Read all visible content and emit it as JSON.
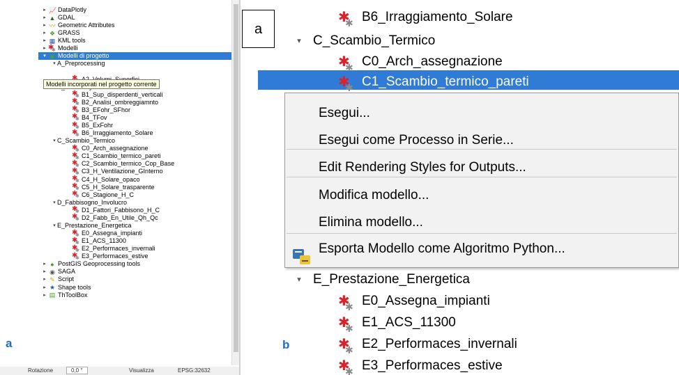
{
  "left_panel": {
    "label": "a",
    "tree": [
      {
        "text": "DataPlotly",
        "icon": "dataplotly-icon",
        "level": 0,
        "arrow": "▸"
      },
      {
        "text": "GDAL",
        "icon": "gdal-icon",
        "level": 0,
        "arrow": "▸"
      },
      {
        "text": "Geometric Attributes",
        "icon": "geometric-attributes-icon",
        "level": 0,
        "arrow": "▸"
      },
      {
        "text": "GRASS",
        "icon": "grass-icon",
        "level": 0,
        "arrow": "▸"
      },
      {
        "text": "KML tools",
        "icon": "kml-icon",
        "level": 0,
        "arrow": "▸"
      },
      {
        "text": "Modelli",
        "icon": "gear-icon",
        "level": 0,
        "arrow": "▸"
      },
      {
        "text": "Modelli di progetto",
        "icon": "project-models-icon",
        "level": 0,
        "arrow": "▾",
        "selected": true
      },
      {
        "text": "A_Preprocessing",
        "icon": "",
        "level": 1,
        "arrow": "▾"
      },
      {
        "text": "",
        "icon": "",
        "level": 2,
        "arrow": ""
      },
      {
        "text": "A2_Volumi_Superfici",
        "icon": "gear-icon",
        "level": 2,
        "arrow": ""
      },
      {
        "text": "B_Geometry",
        "icon": "",
        "level": 1,
        "arrow": "▾"
      },
      {
        "text": "B1_Sup_disperdenti_verticali",
        "icon": "gear-icon",
        "level": 2,
        "arrow": ""
      },
      {
        "text": "B2_Analisi_ombreggiamnto",
        "icon": "gear-icon",
        "level": 2,
        "arrow": ""
      },
      {
        "text": "B3_EFohr_SFhor",
        "icon": "gear-icon",
        "level": 2,
        "arrow": ""
      },
      {
        "text": "B4_TFov",
        "icon": "gear-icon",
        "level": 2,
        "arrow": ""
      },
      {
        "text": "B5_ExFohr",
        "icon": "gear-icon",
        "level": 2,
        "arrow": ""
      },
      {
        "text": "B6_Irraggiamento_Solare",
        "icon": "gear-icon",
        "level": 2,
        "arrow": ""
      },
      {
        "text": "C_Scambio_Termico",
        "icon": "",
        "level": 1,
        "arrow": "▾"
      },
      {
        "text": "C0_Arch_assegnazione",
        "icon": "gear-icon",
        "level": 2,
        "arrow": ""
      },
      {
        "text": "C1_Scambio_termico_pareti",
        "icon": "gear-icon",
        "level": 2,
        "arrow": ""
      },
      {
        "text": "C2_Scambio_termico_Cop_Base",
        "icon": "gear-icon",
        "level": 2,
        "arrow": ""
      },
      {
        "text": "C3_H_Ventilazione_GInterno",
        "icon": "gear-icon",
        "level": 2,
        "arrow": ""
      },
      {
        "text": "C4_H_Solare_opaco",
        "icon": "gear-icon",
        "level": 2,
        "arrow": ""
      },
      {
        "text": "C5_H_Solare_trasparente",
        "icon": "gear-icon",
        "level": 2,
        "arrow": ""
      },
      {
        "text": "C6_Stagione_H_C",
        "icon": "gear-icon",
        "level": 2,
        "arrow": ""
      },
      {
        "text": "D_Fabbisogno_Involucro",
        "icon": "",
        "level": 1,
        "arrow": "▾"
      },
      {
        "text": "D1_Fattori_Fabbisono_H_C",
        "icon": "gear-icon",
        "level": 2,
        "arrow": ""
      },
      {
        "text": "D2_Fabb_En_Utile_Qh_Qc",
        "icon": "gear-icon",
        "level": 2,
        "arrow": ""
      },
      {
        "text": "E_Prestazione_Energetica",
        "icon": "",
        "level": 1,
        "arrow": "▾"
      },
      {
        "text": "E0_Assegna_impianti",
        "icon": "gear-icon",
        "level": 2,
        "arrow": ""
      },
      {
        "text": "E1_ACS_11300",
        "icon": "gear-icon",
        "level": 2,
        "arrow": ""
      },
      {
        "text": "E2_Performaces_invernali",
        "icon": "gear-icon",
        "level": 2,
        "arrow": ""
      },
      {
        "text": "E3_Performaces_estive",
        "icon": "gear-icon",
        "level": 2,
        "arrow": ""
      },
      {
        "text": "PostGIS Geoprocessing tools",
        "icon": "postgis-icon",
        "level": 0,
        "arrow": "▸"
      },
      {
        "text": "SAGA",
        "icon": "saga-icon",
        "level": 0,
        "arrow": "▸"
      },
      {
        "text": "Script",
        "icon": "script-icon",
        "level": 0,
        "arrow": "▸"
      },
      {
        "text": "Shape tools",
        "icon": "shape-tools-icon",
        "level": 0,
        "arrow": "▸"
      },
      {
        "text": "ThToolBox",
        "icon": "thtoolbox-icon",
        "level": 0,
        "arrow": "▸"
      }
    ],
    "tooltip": "Modelli incorporati nel progetto corrente",
    "statusbar": {
      "rotation_label": "Rotazione",
      "rotation_value": "0,0 °",
      "render_label": "Visualizza",
      "crs": "EPSG:32632"
    }
  },
  "right_panel": {
    "label": "b",
    "box_label": "a",
    "tree": [
      {
        "text": "B6_Irraggiamento_Solare",
        "level": 2,
        "arrow": ""
      },
      {
        "text": "C_Scambio_Termico",
        "level": 1,
        "arrow": "▾"
      },
      {
        "text": "C0_Arch_assegnazione",
        "level": 2,
        "arrow": ""
      },
      {
        "text": "C1_Scambio_termico_pareti",
        "level": 2,
        "arrow": "",
        "selected": true
      },
      {
        "text": "E_Prestazione_Energetica",
        "level": 1,
        "arrow": "▾"
      },
      {
        "text": "E0_Assegna_impianti",
        "level": 2,
        "arrow": ""
      },
      {
        "text": "E1_ACS_11300",
        "level": 2,
        "arrow": ""
      },
      {
        "text": "E2_Performaces_invernali",
        "level": 2,
        "arrow": ""
      },
      {
        "text": "E3_Performaces_estive",
        "level": 2,
        "arrow": ""
      }
    ],
    "context_menu": {
      "execute": "Esegui...",
      "batch": "Esegui come Processo in Serie...",
      "edit_styles": "Edit Rendering Styles for Outputs...",
      "edit_model": "Modifica modello...",
      "delete_model": "Elimina modello...",
      "export_python": "Esporta Modello come Algoritmo Python..."
    }
  },
  "colors": {
    "selection": "#2f7bd6",
    "label_blue": "#1f6dbf",
    "gear_red": "#d8232a"
  }
}
